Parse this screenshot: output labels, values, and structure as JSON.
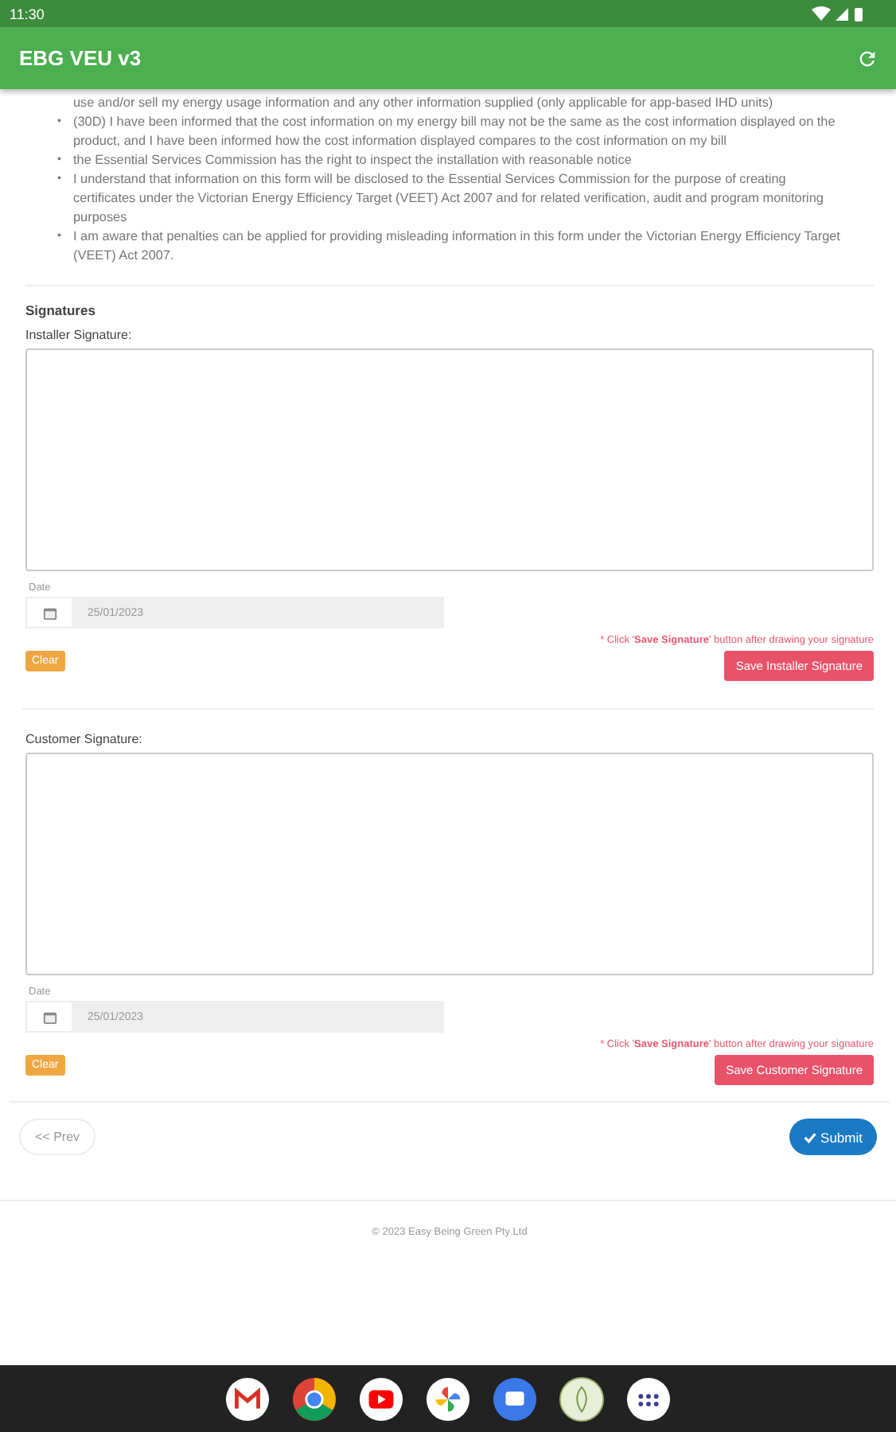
{
  "status_bar": {
    "time": "11:30"
  },
  "app_bar": {
    "title": "EBG VEU v3"
  },
  "declarations": [
    {
      "text": "use and/or sell my energy usage information and any other information supplied (only applicable for app-based IHD units)"
    },
    {
      "marker": "•",
      "text": "(30D) I have been informed that the cost information on my energy bill may not be the same as the cost information displayed on the product, and I have been informed how the cost information displayed compares to the cost information on my bill"
    },
    {
      "marker": "•",
      "text": "the Essential Services Commission has the right to inspect the installation with reasonable notice"
    },
    {
      "marker": "•",
      "text": "I understand that information on this form will be disclosed to the Essential Services Commission for the purpose of creating certificates under the Victorian Energy Efficiency Target (VEET) Act 2007 and for related verification, audit and program monitoring purposes"
    },
    {
      "marker": "•",
      "text": "I am aware that penalties can be applied for providing misleading information in this form under the Victorian Energy Efficiency Target (VEET) Act 2007."
    }
  ],
  "section_title": "Signatures",
  "signatures": [
    {
      "label": "Installer Signature:",
      "date_label": "Date",
      "date": "25/01/2023",
      "note": "* Click '**Save Signature**' button after drawing your signature",
      "clear": "Clear",
      "save": "Save Installer Signature"
    },
    {
      "label": "Customer Signature:",
      "date_label": "Date",
      "date": "25/01/2023",
      "note": "* Click '**Save Signature**' button after drawing your signature",
      "clear": "Clear",
      "save": "Save Customer Signature"
    }
  ],
  "nav": {
    "prev": "<< Prev",
    "submit": "Submit"
  },
  "footer": "© 2023 Easy Being Green Pty Ltd"
}
